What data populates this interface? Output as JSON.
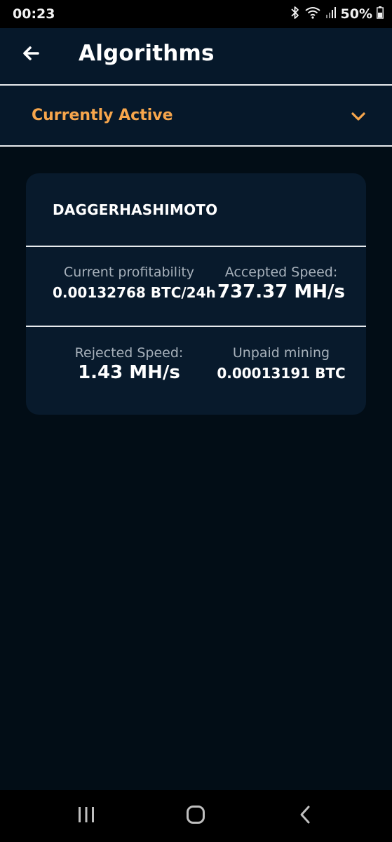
{
  "status_bar": {
    "time": "00:23",
    "battery": "50%",
    "icons": [
      "bluetooth-icon",
      "wifi-icon",
      "signal-icon",
      "battery-icon"
    ]
  },
  "header": {
    "title": "Algorithms",
    "back_icon": "arrow-left-icon"
  },
  "filter": {
    "label": "Currently Active",
    "icon": "chevron-down-icon",
    "color": "#f7a64c"
  },
  "algorithm_card": {
    "name": "DAGGERHASHIMOTO",
    "stats": {
      "current_profitability": {
        "label": "Current profitability",
        "value": "0.00132768 BTC/24h"
      },
      "accepted_speed": {
        "label": "Accepted Speed:",
        "value": "737.37 MH/s"
      },
      "rejected_speed": {
        "label": "Rejected Speed:",
        "value": "1.43 MH/s"
      },
      "unpaid_mining": {
        "label": "Unpaid mining",
        "value": "0.00013191 BTC"
      }
    }
  },
  "nav_bar": {
    "icons": [
      "recent-apps-icon",
      "home-icon",
      "back-icon"
    ]
  },
  "colors": {
    "background": "#020d16",
    "header": "#06182a",
    "card": "#081a2c",
    "accent": "#f7a64c"
  }
}
